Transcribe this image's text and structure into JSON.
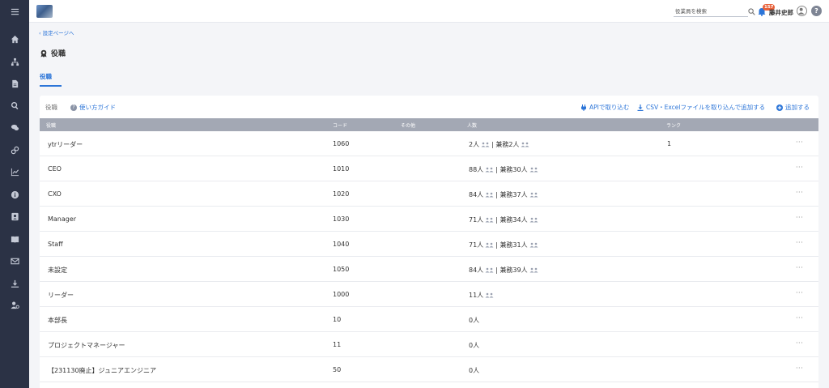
{
  "sidebar": {
    "icons": [
      "menu-icon",
      "home-icon",
      "org-chart-icon",
      "document-icon",
      "search-icon",
      "chat-icon",
      "link-icon",
      "chart-icon",
      "info-icon",
      "profile-card-icon",
      "book-icon",
      "mail-icon",
      "download-icon",
      "user-settings-icon"
    ]
  },
  "header": {
    "search_placeholder": "役業員を検索",
    "notification_count": "157",
    "username": "藤井史郎",
    "help_label": "?"
  },
  "breadcrumb": {
    "back_label": "設定ページへ"
  },
  "page": {
    "title": "役職"
  },
  "tabs": [
    {
      "label": "役職",
      "active": true
    }
  ],
  "card": {
    "label": "役職",
    "guide_label": "使い方ガイド",
    "guide_icon": "?",
    "actions": {
      "api_label": "APIで取り込む",
      "csv_label": "CSV・Excelファイルを取り込んで追加する",
      "add_label": "追加する"
    }
  },
  "table": {
    "columns": [
      "役職",
      "コード",
      "その他",
      "人数",
      "ランク"
    ],
    "more_label": "···",
    "rows": [
      {
        "name": "ytrリーダー",
        "code": "1060",
        "count": "2人",
        "concurrent": "兼務2人",
        "rank": "1"
      },
      {
        "name": "CEO",
        "code": "1010",
        "count": "88人",
        "concurrent": "兼務30人",
        "rank": ""
      },
      {
        "name": "CXO",
        "code": "1020",
        "count": "84人",
        "concurrent": "兼務37人",
        "rank": ""
      },
      {
        "name": "Manager",
        "code": "1030",
        "count": "71人",
        "concurrent": "兼務34人",
        "rank": ""
      },
      {
        "name": "Staff",
        "code": "1040",
        "count": "71人",
        "concurrent": "兼務31人",
        "rank": ""
      },
      {
        "name": "未設定",
        "code": "1050",
        "count": "84人",
        "concurrent": "兼務39人",
        "rank": ""
      },
      {
        "name": "リーダー",
        "code": "1000",
        "count": "11人",
        "concurrent": "",
        "rank": ""
      },
      {
        "name": "本部長",
        "code": "10",
        "count": "0人",
        "concurrent": "",
        "rank": ""
      },
      {
        "name": "プロジェクトマネージャー",
        "code": "11",
        "count": "0人",
        "concurrent": "",
        "rank": ""
      },
      {
        "name": "【231130廃止】ジュニアエンジニア",
        "code": "50",
        "count": "0人",
        "concurrent": "",
        "rank": ""
      }
    ]
  },
  "colors": {
    "sidebar": "#2b3245",
    "accent": "#2c75d8",
    "table_header": "#a3a8b4",
    "badge": "#e8613a"
  }
}
